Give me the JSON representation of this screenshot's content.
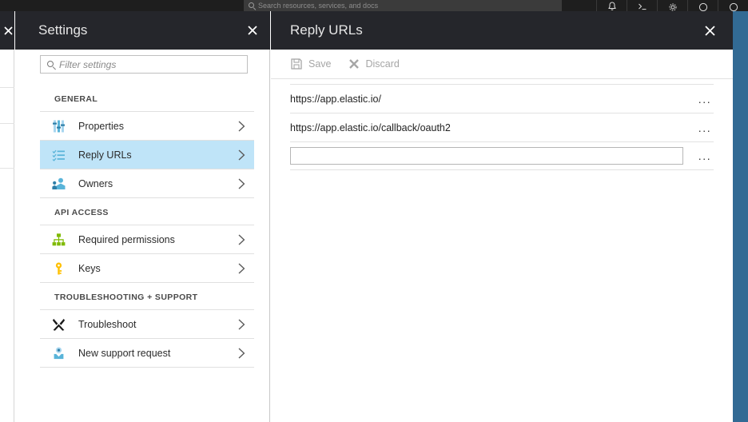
{
  "topbar": {
    "search_placeholder": "Search resources, services, and docs",
    "icons": [
      "notifications-bell-icon",
      "cloud-shell-icon",
      "settings-gear-icon",
      "help-icon",
      "feedback-icon"
    ]
  },
  "colors": {
    "blade_header_bg": "#25262b",
    "selected_item_bg": "#bfe4f8",
    "accent_blue": "#0072c6",
    "peek_blade_blue": "#326a94",
    "icon_green": "#7fba00",
    "icon_yellow": "#ffc000",
    "icon_blue": "#59b4d9",
    "disabled_text": "#a6a6a6"
  },
  "settings_blade": {
    "title": "Settings",
    "close_label": "Close",
    "filter": {
      "placeholder": "Filter settings",
      "value": "",
      "icon": "search-icon"
    },
    "groups": [
      {
        "label": "GENERAL",
        "items": [
          {
            "label": "Properties",
            "icon": "sliders-icon",
            "selected": false
          },
          {
            "label": "Reply URLs",
            "icon": "checklist-icon",
            "selected": true
          },
          {
            "label": "Owners",
            "icon": "people-icon",
            "selected": false
          }
        ]
      },
      {
        "label": "API ACCESS",
        "items": [
          {
            "label": "Required permissions",
            "icon": "hierarchy-icon",
            "selected": false
          },
          {
            "label": "Keys",
            "icon": "key-icon",
            "selected": false
          }
        ]
      },
      {
        "label": "TROUBLESHOOTING + SUPPORT",
        "items": [
          {
            "label": "Troubleshoot",
            "icon": "tools-icon",
            "selected": false
          },
          {
            "label": "New support request",
            "icon": "support-person-icon",
            "selected": false
          }
        ]
      }
    ]
  },
  "reply_urls_blade": {
    "title": "Reply URLs",
    "close_label": "Close",
    "commands": [
      {
        "label": "Save",
        "icon": "save-disk-icon",
        "enabled": false
      },
      {
        "label": "Discard",
        "icon": "discard-x-icon",
        "enabled": false
      }
    ],
    "rows": [
      {
        "value": "https://app.elastic.io/",
        "editable": false,
        "menu": "..."
      },
      {
        "value": "https://app.elastic.io/callback/oauth2",
        "editable": false,
        "menu": "..."
      },
      {
        "value": "",
        "editable": true,
        "placeholder": "",
        "menu": "..."
      }
    ]
  }
}
